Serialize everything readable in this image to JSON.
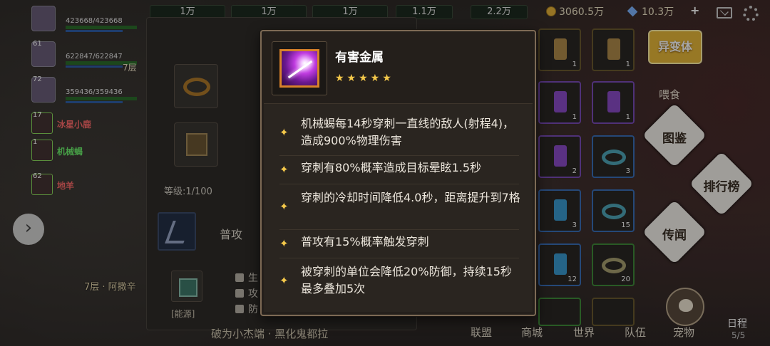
{
  "top_bar": {
    "resources": [
      "1万",
      "1万",
      "1万",
      "1.1万",
      "2.2万"
    ],
    "gold": "3060.5万",
    "diamonds": "10.3万",
    "plus": "+"
  },
  "party": [
    {
      "level": "",
      "hp": "423668/423668"
    },
    {
      "level": "61",
      "hp": "622847/622847"
    },
    {
      "level": "72",
      "hp": "359436/359436"
    }
  ],
  "floor_small": "7层",
  "pets": [
    {
      "level": "17",
      "name": "冰星小鹿"
    },
    {
      "level": "1",
      "name": "机械蝎"
    },
    {
      "level": "62",
      "name": "地羊"
    }
  ],
  "floor_label": "7层 · 阿撒辛",
  "detail": {
    "level_text": "等级:1/100",
    "attack_label": "普攻",
    "energy_label": "[能源]",
    "stats": [
      "生",
      "攻",
      "防"
    ],
    "bottom_text": "破为小杰端 · 黑化鬼都拉"
  },
  "inventory_counts": [
    "1",
    "1",
    "1",
    "1",
    "2",
    "3",
    "3",
    "15",
    "12",
    "20"
  ],
  "right_panel": {
    "mutant_button": "异变体",
    "feed_label": "喂食",
    "catalog_button": "图鉴",
    "ranking_button": "排行榜",
    "rumor_button": "传闻",
    "schedule_label": "日程",
    "schedule_count": "5/5"
  },
  "bottom_nav": [
    "联盟",
    "商城",
    "世界",
    "队伍",
    "宠物"
  ],
  "tooltip": {
    "title": "有害金属",
    "stars": "★★★★★",
    "effects": [
      "机械蝎每14秒穿刺一直线的敌人(射程4)，造成900%物理伤害",
      "穿刺有80%概率造成目标晕眩1.5秒",
      "穿刺的冷却时间降低4.0秒，距离提升到7格",
      "普攻有15%概率触发穿刺",
      "被穿刺的单位会降低20%防御，持续15秒最多叠加5次"
    ]
  },
  "colors": {
    "star": "#f4c84a",
    "tooltip_bg": "#241f1b",
    "tooltip_border": "#7d6a55",
    "mutant_button": "#e8b83a"
  }
}
